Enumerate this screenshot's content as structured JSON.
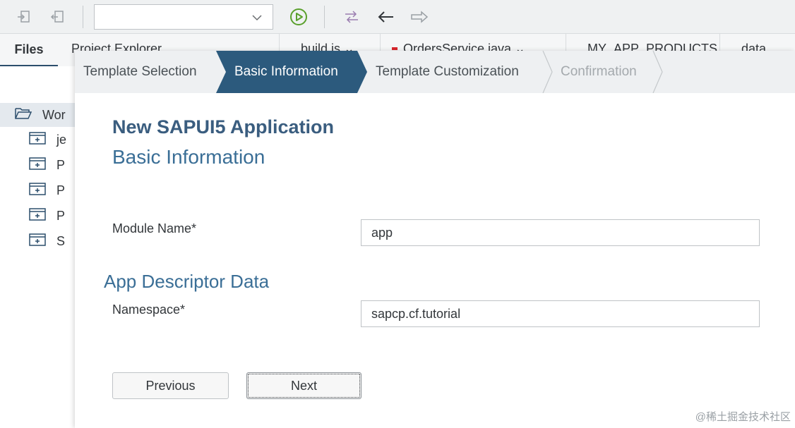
{
  "toolbar": {
    "combo_value": "",
    "icons": [
      "import-icon",
      "export-icon",
      "chevron-down-icon",
      "run-icon",
      "git-compare-icon",
      "back-arrow-icon",
      "forward-arrow-icon"
    ]
  },
  "panel_tabs": {
    "files": "Files",
    "project_explorer": "Project Explorer"
  },
  "editor_tabs": [
    {
      "label": "build.js ⌄"
    },
    {
      "label": "OrdersService.java ⌄"
    },
    {
      "label": "MY_APP_PRODUCTS ⌄"
    },
    {
      "label": "data"
    }
  ],
  "tree": {
    "root": "Wor",
    "items": [
      "je",
      "P",
      "P",
      "P",
      "S"
    ]
  },
  "wizard": {
    "steps": [
      {
        "label": "Template Selection",
        "state": "done"
      },
      {
        "label": "Basic Information",
        "state": "active"
      },
      {
        "label": "Template Customization",
        "state": "pending"
      },
      {
        "label": "Confirmation",
        "state": "disabled"
      }
    ],
    "title": "New SAPUI5 Application",
    "subtitle": "Basic Information",
    "module_name": {
      "label": "Module Name*",
      "value": "app"
    },
    "section": "App Descriptor Data",
    "namespace": {
      "label": "Namespace*",
      "value": "sapcp.cf.tutorial"
    },
    "buttons": {
      "previous": "Previous",
      "next": "Next"
    }
  },
  "watermark": "@稀土掘金技术社区",
  "colors": {
    "active_step": "#2c5a7d",
    "title": "#3a5d7f",
    "accent": "#3a6e96",
    "run_icon": "#5aa02c"
  }
}
